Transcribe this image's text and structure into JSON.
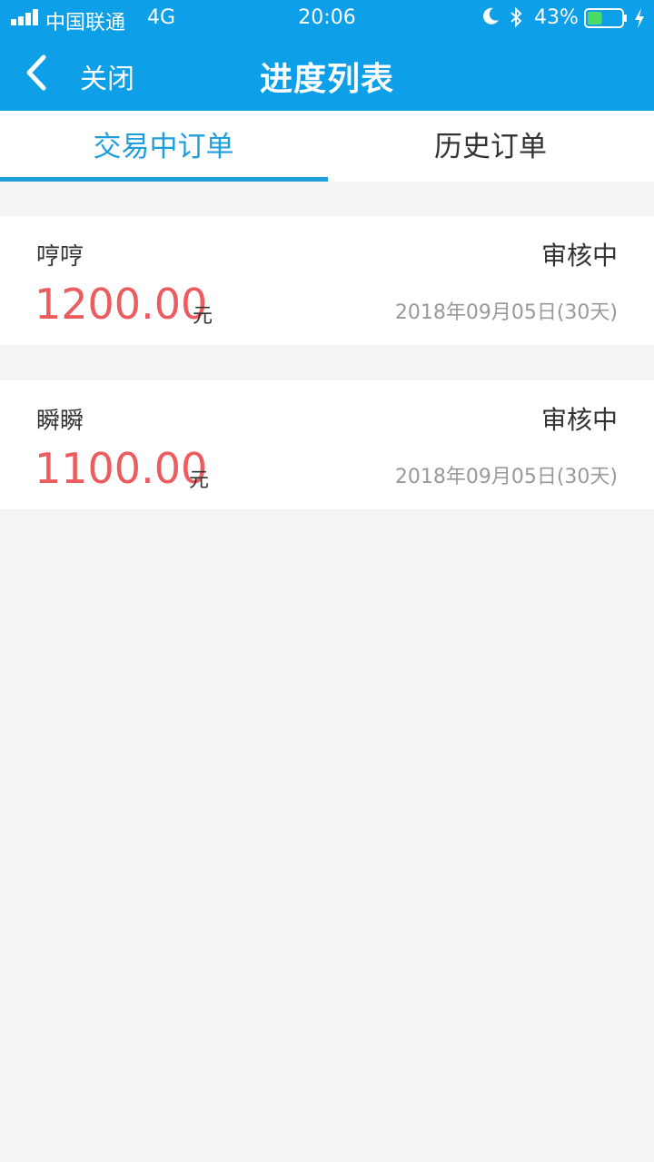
{
  "status_bar": {
    "carrier": "中国联通",
    "network": "4G",
    "time": "20:06",
    "battery_percent": "43%",
    "battery_level": 0.43,
    "icons": [
      "signal-icon",
      "moon-icon",
      "bluetooth-icon",
      "battery-icon",
      "charging-icon"
    ]
  },
  "header": {
    "back_label": "关闭",
    "title": "进度列表",
    "background_color": "#0d9fe8"
  },
  "tabs": [
    {
      "label": "交易中订单",
      "active": true
    },
    {
      "label": "历史订单",
      "active": false
    }
  ],
  "orders": [
    {
      "name": "哼哼",
      "status": "审核中",
      "amount": "1200.00",
      "unit": "元",
      "date": "2018年09月05日(30天)"
    },
    {
      "name": "瞬瞬",
      "status": "审核中",
      "amount": "1100.00",
      "unit": "元",
      "date": "2018年09月05日(30天)"
    }
  ],
  "colors": {
    "accent": "#1e9fdc",
    "amount": "#ec5b5e",
    "background": "#f4f4f4"
  }
}
